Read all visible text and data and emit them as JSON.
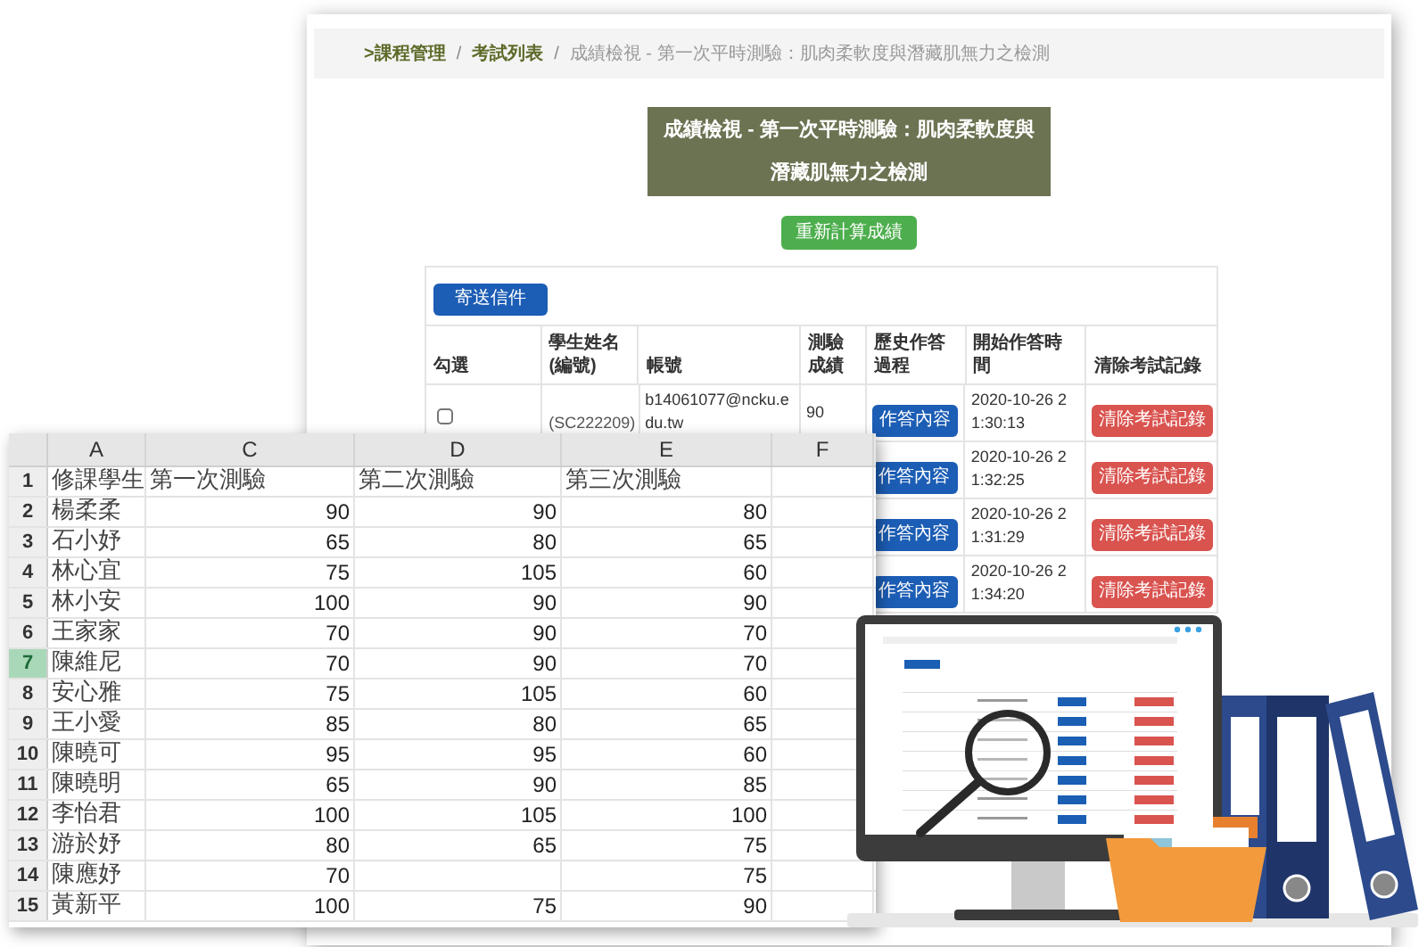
{
  "web_page": {
    "breadcrumb": {
      "separator": "/",
      "items": [
        {
          "label": ">課程管理",
          "kind": "link"
        },
        {
          "label": "考試列表",
          "kind": "link"
        },
        {
          "label": "成績檢視 - 第一次平時測驗：肌肉柔軟度與潛藏肌無力之檢測",
          "kind": "current"
        }
      ]
    },
    "title": "成績檢視 - 第一次平時測驗：肌肉柔軟度與潛藏肌無力之檢測",
    "recalculate_button": "重新計算成績",
    "send_mail_button": "寄送信件",
    "table": {
      "columns": [
        "勾選",
        "學生姓名 (編號)",
        "帳號",
        "測驗成績",
        "歷史作答過程",
        "開始作答時間",
        "清除考試記錄"
      ],
      "rows": [
        {
          "checked": false,
          "student_id": "(SC222209)",
          "account": "b14061077@ncku.edu.tw",
          "score": "90",
          "history_button": "作答內容",
          "start_time": "2020-10-26 21:30:13",
          "clear_button": "清除考試記錄"
        },
        {
          "history_button": "作答內容",
          "start_time": "2020-10-26 21:32:25",
          "clear_button": "清除考試記錄"
        },
        {
          "history_button": "作答內容",
          "start_time": "2020-10-26 21:31:29",
          "clear_button": "清除考試記錄"
        },
        {
          "history_button": "作答內容",
          "start_time": "2020-10-26 21:34:20",
          "clear_button": "清除考試記錄"
        }
      ]
    }
  },
  "spreadsheet": {
    "columns": [
      "A",
      "C",
      "D",
      "E",
      "F"
    ],
    "rows": [
      {
        "number": "1",
        "kind": "header",
        "selected": false,
        "cells": [
          "修課學生",
          "第一次測驗",
          "第二次測驗",
          "第三次測驗"
        ]
      },
      {
        "number": "2",
        "kind": "data",
        "selected": false,
        "cells": [
          "楊柔柔",
          "90",
          "90",
          "80"
        ]
      },
      {
        "number": "3",
        "kind": "data",
        "selected": false,
        "cells": [
          "石小妤",
          "65",
          "80",
          "65"
        ]
      },
      {
        "number": "4",
        "kind": "data",
        "selected": false,
        "cells": [
          "林心宜",
          "75",
          "105",
          "60"
        ]
      },
      {
        "number": "5",
        "kind": "data",
        "selected": false,
        "cells": [
          "林小安",
          "100",
          "90",
          "90"
        ]
      },
      {
        "number": "6",
        "kind": "data",
        "selected": false,
        "cells": [
          "王家家",
          "70",
          "90",
          "70"
        ]
      },
      {
        "number": "7",
        "kind": "data",
        "selected": true,
        "cells": [
          "陳維尼",
          "70",
          "90",
          "70"
        ]
      },
      {
        "number": "8",
        "kind": "data",
        "selected": false,
        "cells": [
          "安心雅",
          "75",
          "105",
          "60"
        ]
      },
      {
        "number": "9",
        "kind": "data",
        "selected": false,
        "cells": [
          "王小愛",
          "85",
          "80",
          "65"
        ]
      },
      {
        "number": "10",
        "kind": "data",
        "selected": false,
        "cells": [
          "陳曉可",
          "95",
          "95",
          "60"
        ]
      },
      {
        "number": "11",
        "kind": "data",
        "selected": false,
        "cells": [
          "陳曉明",
          "65",
          "90",
          "85"
        ]
      },
      {
        "number": "12",
        "kind": "data",
        "selected": false,
        "cells": [
          "李怡君",
          "100",
          "105",
          "100"
        ]
      },
      {
        "number": "13",
        "kind": "data",
        "selected": false,
        "cells": [
          "游於妤",
          "80",
          "65",
          "75"
        ]
      },
      {
        "number": "14",
        "kind": "data",
        "selected": false,
        "cells": [
          "陳應妤",
          "70",
          null,
          "75"
        ]
      },
      {
        "number": "15",
        "kind": "data",
        "selected": false,
        "cells": [
          "黃新平",
          "100",
          "75",
          "90"
        ]
      }
    ]
  }
}
